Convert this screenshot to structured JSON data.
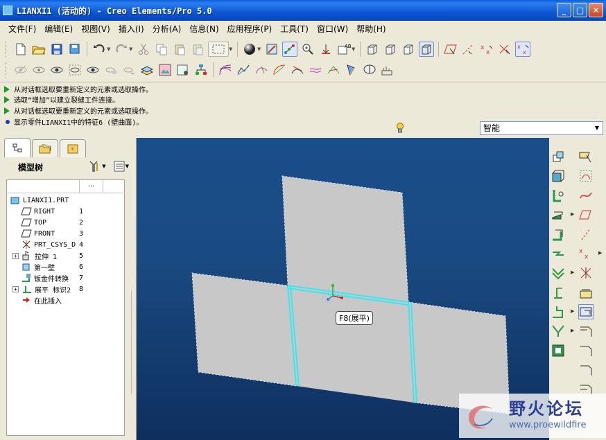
{
  "window": {
    "title": "LIANXI1 (活动的) - Creo Elements/Pro 5.0",
    "minimize": "_",
    "maximize": "□",
    "close": "✕"
  },
  "menu": [
    "文件(F)",
    "编辑(E)",
    "视图(V)",
    "插入(I)",
    "分析(A)",
    "信息(N)",
    "应用程序(P)",
    "工具(T)",
    "窗口(W)",
    "帮助(H)"
  ],
  "messages": [
    {
      "type": "prompt",
      "text": "从对话框选取要重新定义的元素或选取操作。"
    },
    {
      "type": "prompt",
      "text": "选取“增加”以建立裂缝工件连接。"
    },
    {
      "type": "prompt",
      "text": "从对话框选取要重新定义的元素或选取操作。"
    },
    {
      "type": "info",
      "text": "显示零件LIANXI1中的特征6 (壁曲面)。"
    }
  ],
  "filter": {
    "selected": "智能"
  },
  "left_panel": {
    "title": "模型树",
    "column_header": "...",
    "tree": [
      {
        "label": "LIANXI1.PRT",
        "icon": "part-icon",
        "num": ""
      },
      {
        "label": "RIGHT",
        "icon": "datum-plane-icon",
        "num": "1"
      },
      {
        "label": "TOP",
        "icon": "datum-plane-icon",
        "num": "2"
      },
      {
        "label": "FRONT",
        "icon": "datum-plane-icon",
        "num": "3"
      },
      {
        "label": "PRT_CSYS_D",
        "icon": "csys-icon",
        "num": "4"
      },
      {
        "label": "拉伸 1",
        "icon": "extrude-icon",
        "num": "5"
      },
      {
        "label": "第一壁",
        "icon": "wall-icon",
        "num": "6"
      },
      {
        "label": "钣金件转换",
        "icon": "sheetmetal-convert-icon",
        "num": "7"
      },
      {
        "label": "展平 标识2",
        "icon": "unbend-icon",
        "num": "8"
      },
      {
        "label": "在此插入",
        "icon": "insert-here-icon",
        "num": ""
      }
    ]
  },
  "viewport": {
    "tooltip": "F8(展平)",
    "background_top": "#1a4e8a",
    "background_bottom": "#0e2f5e",
    "surface_color": "#c8c8c8",
    "edge_highlight": "#38e8f0"
  },
  "watermark": {
    "text": "野火论坛",
    "url": "www.proewildfire"
  }
}
